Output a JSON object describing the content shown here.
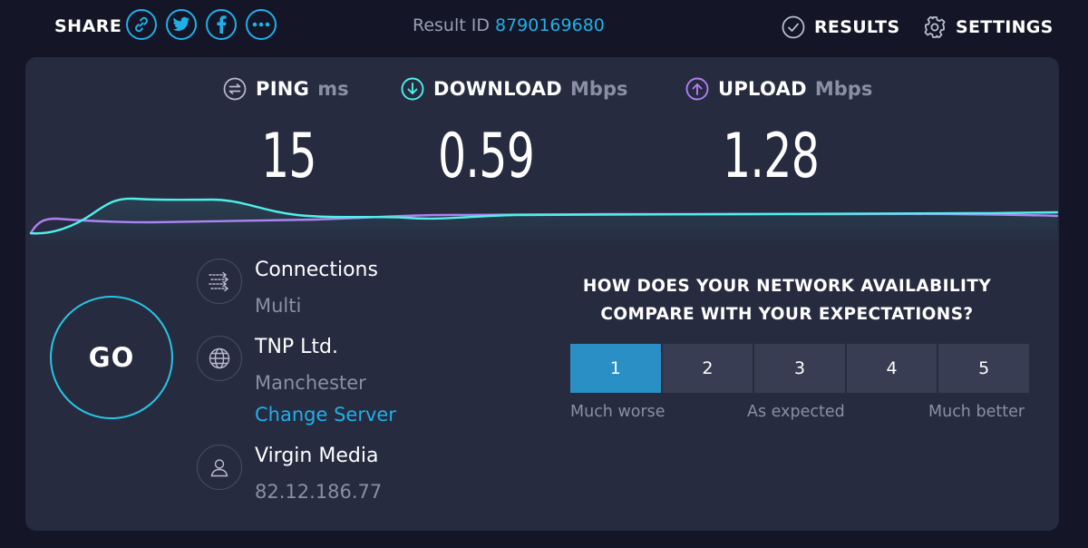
{
  "header": {
    "share_label": "SHARE",
    "share_icons": [
      "link-icon",
      "twitter-icon",
      "facebook-icon",
      "more-icon"
    ],
    "result_id_label": "Result ID",
    "result_id_value": "8790169680",
    "nav": [
      {
        "label": "RESULTS",
        "icon": "check-circle-icon"
      },
      {
        "label": "SETTINGS",
        "icon": "gear-icon"
      }
    ]
  },
  "metrics": {
    "ping": {
      "label": "PING",
      "unit": "ms",
      "value": "15",
      "icon": "ping-icon"
    },
    "download": {
      "label": "DOWNLOAD",
      "unit": "Mbps",
      "value": "0.59",
      "icon": "download-arrow-icon"
    },
    "upload": {
      "label": "UPLOAD",
      "unit": "Mbps",
      "value": "1.28",
      "icon": "upload-arrow-icon"
    }
  },
  "go_button": {
    "label": "GO"
  },
  "connection_info": {
    "connections": {
      "title": "Connections",
      "value": "Multi",
      "icon": "connections-icon"
    },
    "server": {
      "title": "TNP Ltd.",
      "location": "Manchester",
      "change_link": "Change Server",
      "icon": "globe-icon"
    },
    "provider": {
      "title": "Virgin Media",
      "ip": "82.12.186.77",
      "icon": "user-icon"
    }
  },
  "survey": {
    "question_line1": "HOW DOES YOUR NETWORK AVAILABILITY",
    "question_line2": "COMPARE WITH YOUR EXPECTATIONS?",
    "options": [
      "1",
      "2",
      "3",
      "4",
      "5"
    ],
    "selected": "1",
    "scale_low": "Much worse",
    "scale_mid": "As expected",
    "scale_high": "Much better"
  },
  "colors": {
    "background": "#141526",
    "panel": "#262b40",
    "accent_blue": "#1fb0e8",
    "download_cyan": "#4ff0e8",
    "upload_purple": "#b07ff2",
    "rating_selected": "#2a8fc4"
  }
}
